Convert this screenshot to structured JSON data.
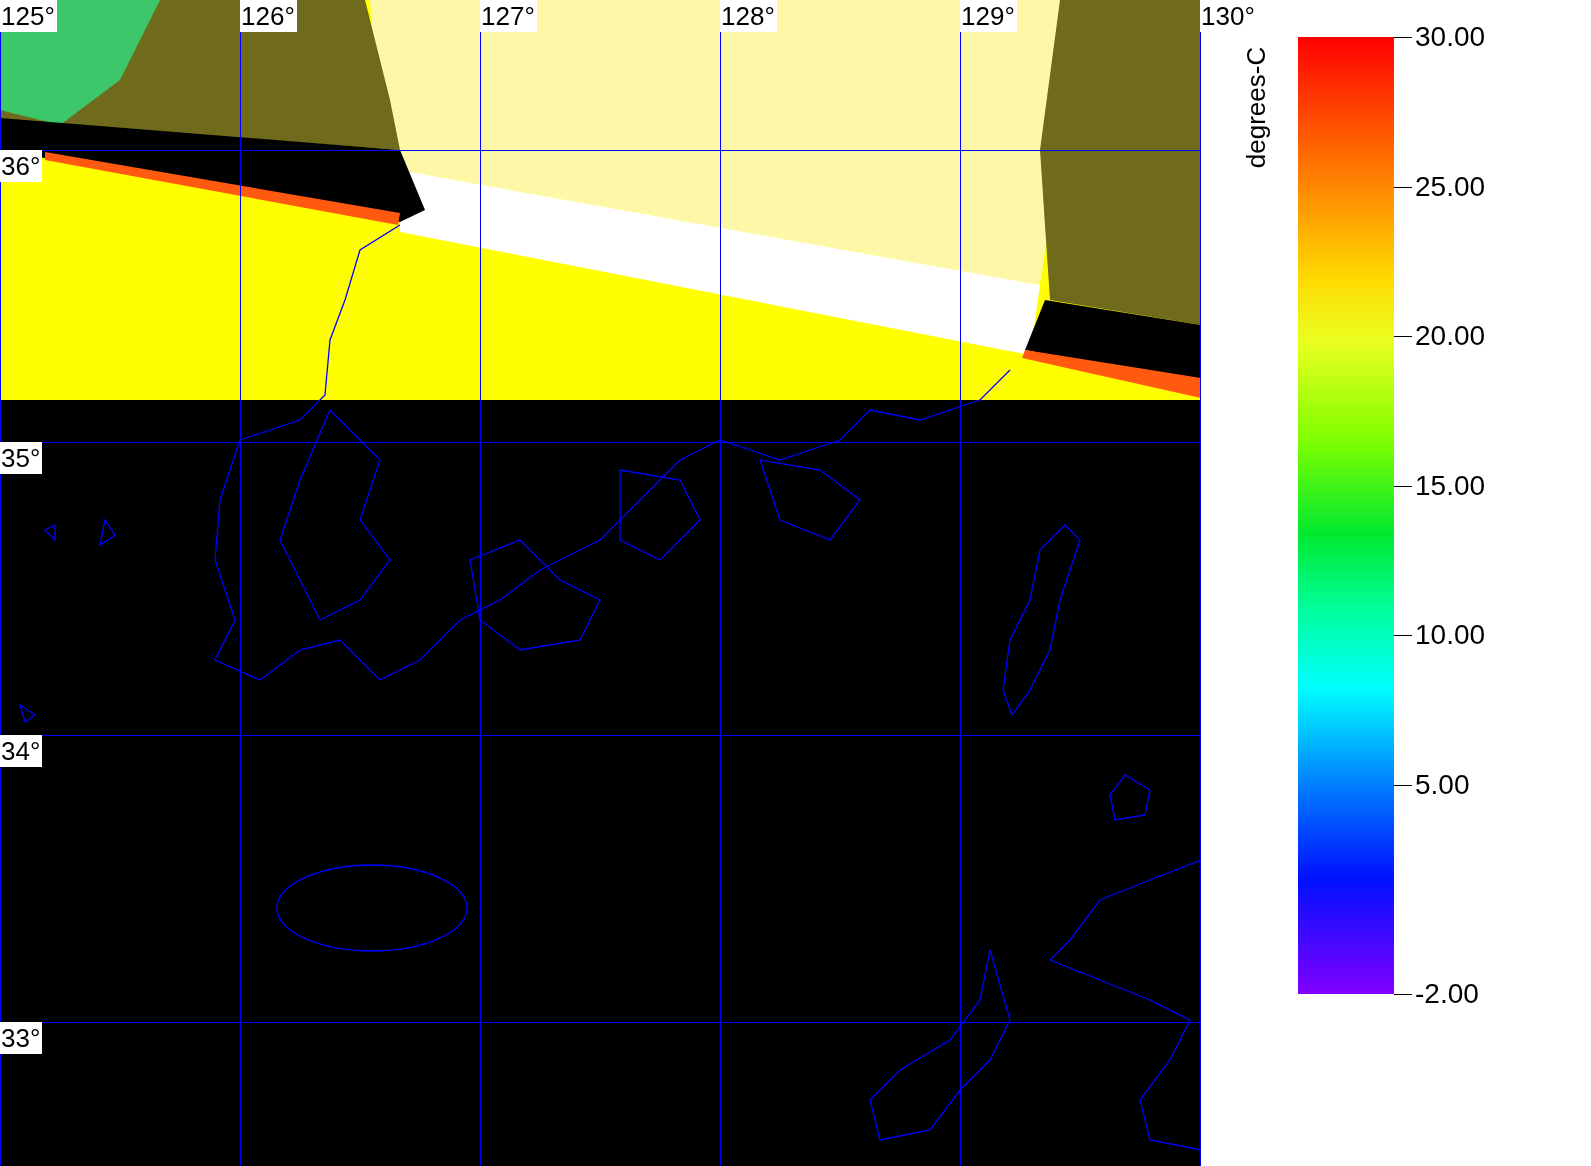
{
  "map": {
    "longitude_labels": [
      "125°",
      "126°",
      "127°",
      "128°",
      "129°",
      "130°"
    ],
    "latitude_labels": [
      "36°",
      "35°",
      "34°",
      "33°"
    ]
  },
  "color_scale": {
    "unit": "degrees-C",
    "ticks": [
      "30.00",
      "25.00",
      "20.00",
      "15.00",
      "10.00",
      "5.00",
      "-2.00"
    ]
  }
}
